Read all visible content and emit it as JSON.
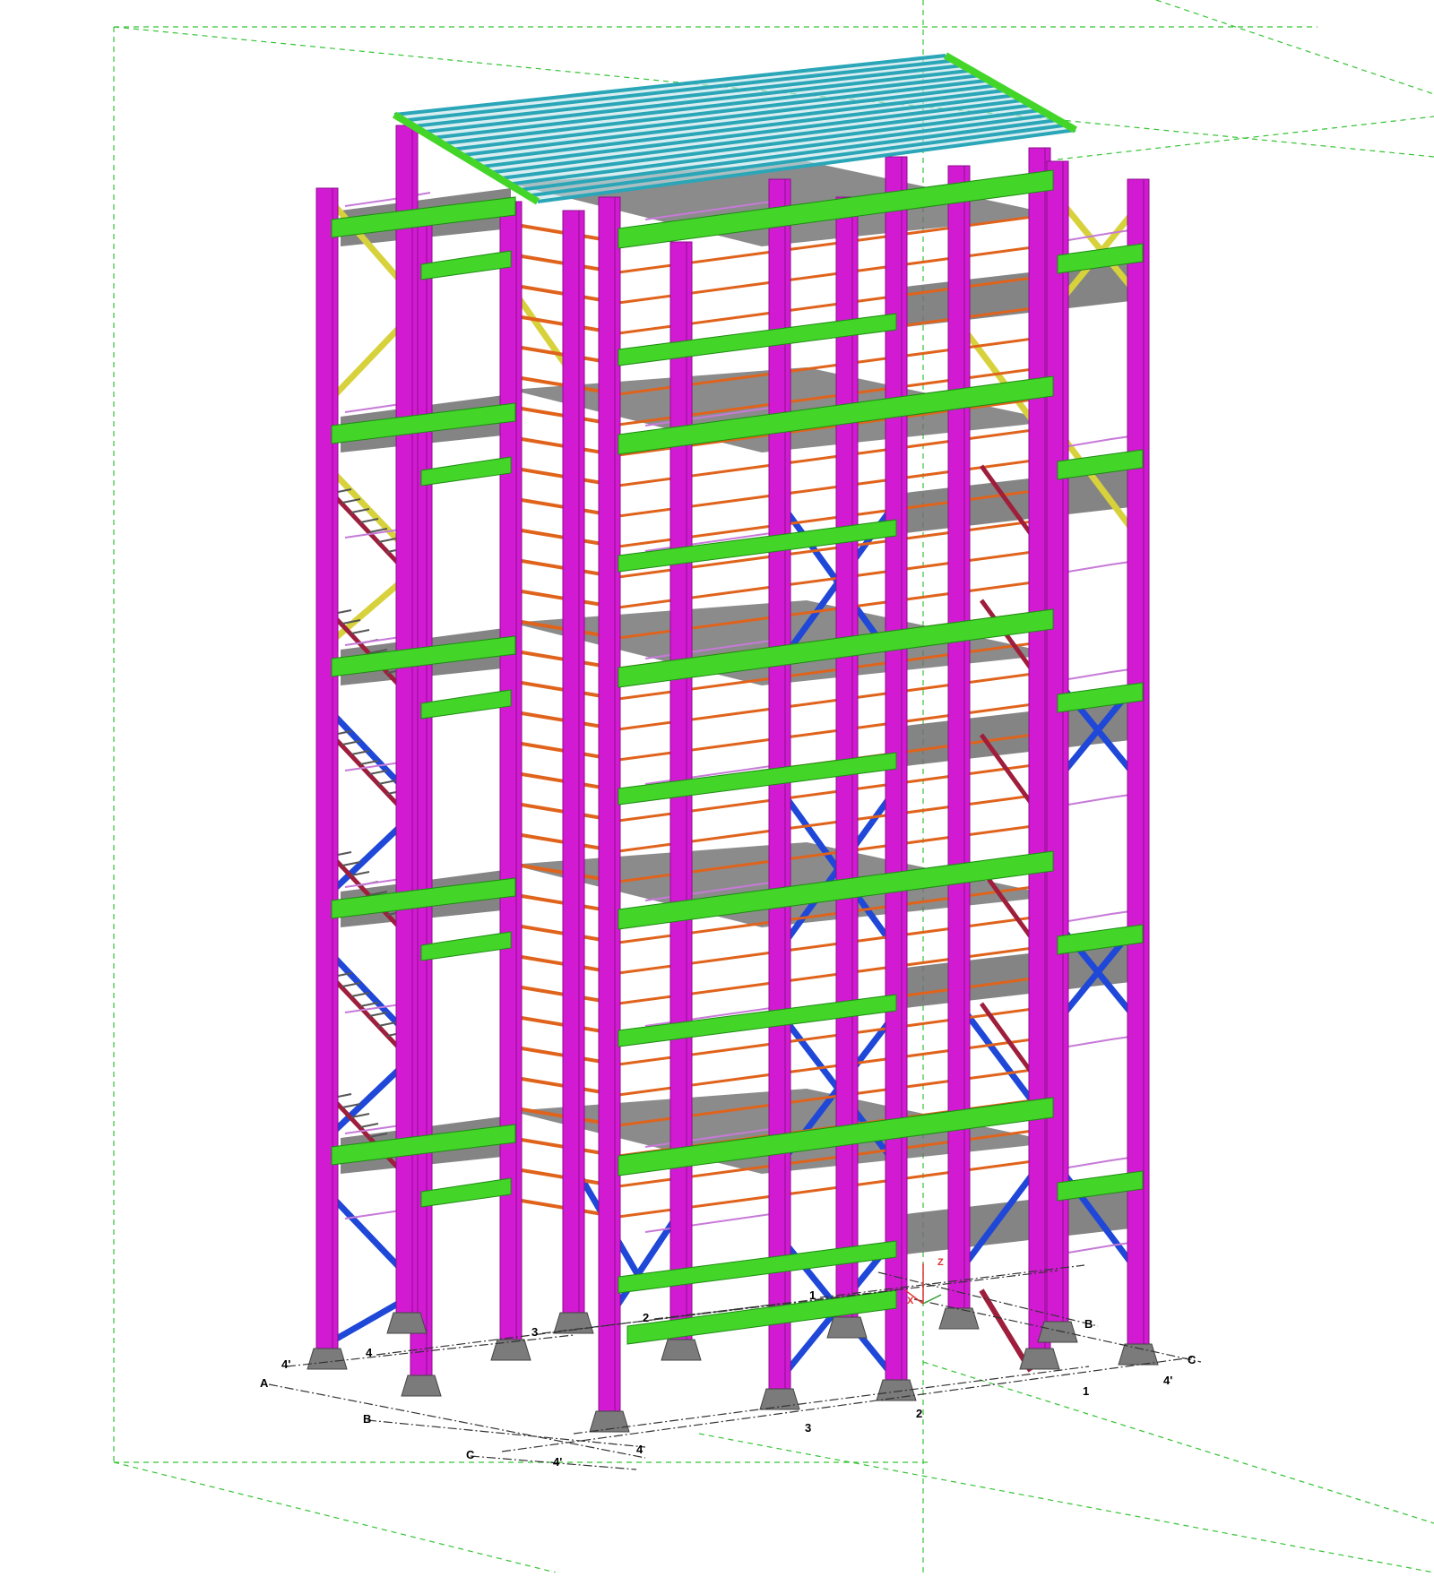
{
  "viewport": {
    "background": "#ffffff",
    "view": "3D model view"
  },
  "colors": {
    "column": "#d21ad2",
    "column_edge": "#8e0f8e",
    "beam_green": "#43d629",
    "beam_green_edge": "#1f8a14",
    "beam_orange": "#e0631c",
    "brace_blue": "#1f47d8",
    "brace_yellow": "#d7d23c",
    "roof_cyan": "#2aa6b8",
    "deck_grey": "#6e6e6e",
    "handrail": "#c77ad8",
    "stair_red": "#9e1e3c",
    "pipe_yellow": "#e6e62a",
    "work_area": "#35c435",
    "footing": "#7b7b7b"
  },
  "grid_labels": {
    "left_letters": [
      "A",
      "B",
      "C"
    ],
    "left_numbers": [
      "4'",
      "4",
      "3",
      "2",
      "1"
    ],
    "right_letters": [
      "B",
      "C"
    ],
    "front_numbers": [
      "4'",
      "4",
      "3",
      "2",
      "1",
      "4'"
    ]
  },
  "axis": {
    "z_label": "Z",
    "x_label": "X"
  }
}
